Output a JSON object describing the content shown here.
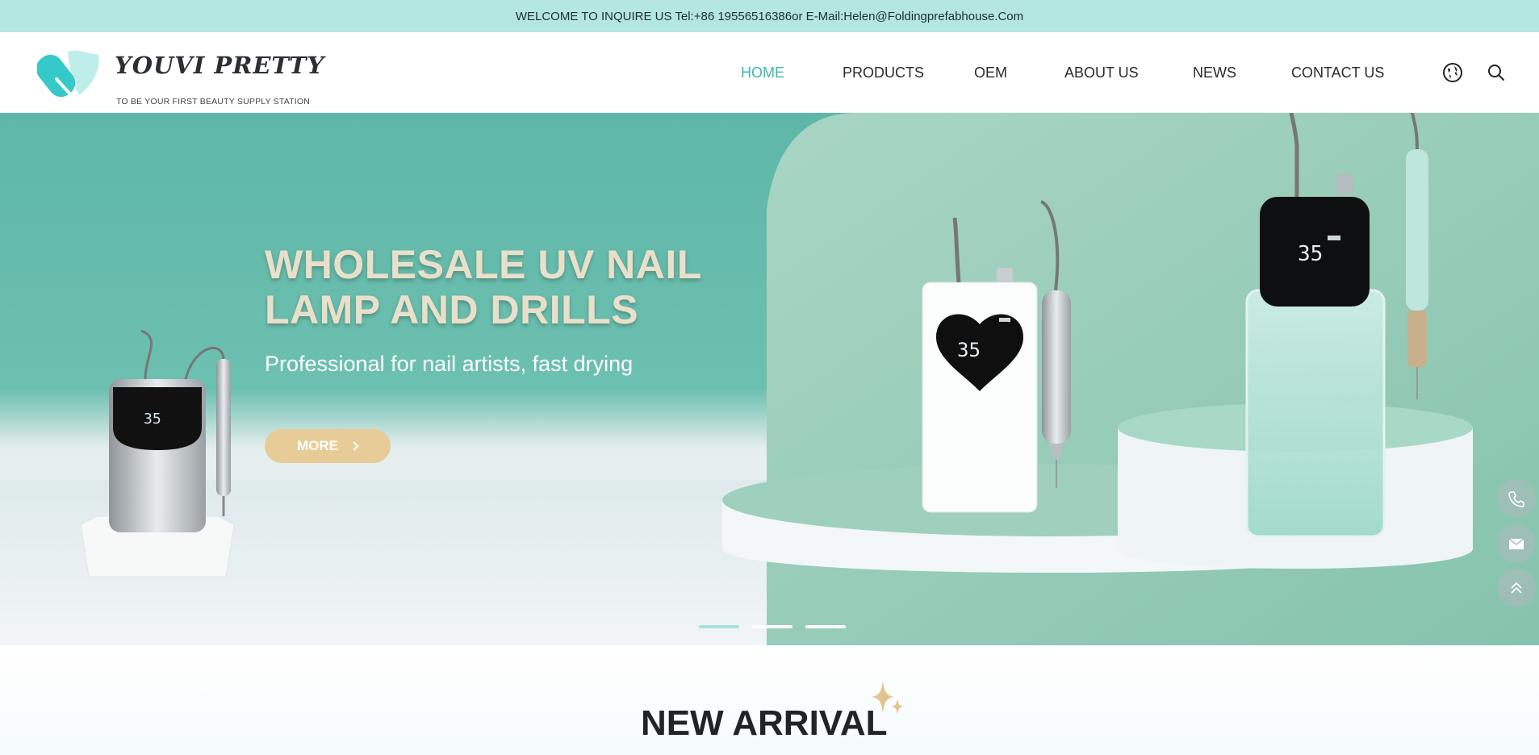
{
  "topbar": {
    "text": "WELCOME TO INQUIRE US Tel:+86 19556516386or E-Mail:Helen@Foldingprefabhouse.Com"
  },
  "brand": {
    "name": "YOUVI PRETTY",
    "tagline": "TO BE YOUR FIRST BEAUTY SUPPLY STATION"
  },
  "nav": {
    "items": [
      {
        "label": "HOME",
        "active": true
      },
      {
        "label": "PRODUCTS",
        "active": false
      },
      {
        "label": "OEM",
        "active": false
      },
      {
        "label": "ABOUT US",
        "active": false
      },
      {
        "label": "NEWS",
        "active": false
      },
      {
        "label": "CONTACT US",
        "active": false
      }
    ],
    "icons": [
      "globe-icon",
      "search-icon"
    ]
  },
  "hero": {
    "title": "WHOLESALE UV NAIL LAMP AND DRILLS",
    "subtitle": "Professional for nail artists, fast drying",
    "button_label": "MORE",
    "device_readout": "35",
    "slides": 3,
    "active_slide": 1
  },
  "float_buttons": [
    "phone-icon",
    "mail-icon",
    "back-to-top-icon"
  ],
  "section": {
    "title": "NEW ARRIVAL"
  },
  "colors": {
    "accent": "#3bb8b0",
    "topbar": "#b4e6e2",
    "button": "#e8cc97",
    "hero_teal": "#5eb7a7"
  }
}
